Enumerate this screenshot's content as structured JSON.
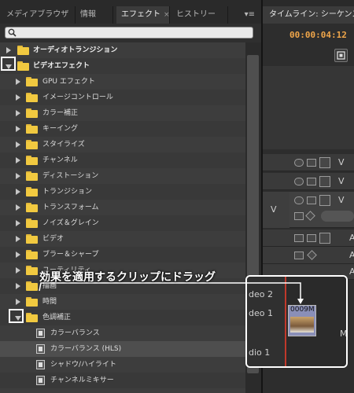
{
  "panel_tabs": [
    {
      "label": "メディアブラウザ",
      "active": false
    },
    {
      "label": "情報",
      "active": false
    },
    {
      "label": "エフェクト",
      "active": true,
      "close": "×"
    },
    {
      "label": "ヒストリー",
      "active": false
    }
  ],
  "panel_menu_glyph": "▾≡",
  "search": {
    "placeholder": ""
  },
  "tree": [
    {
      "label": "オーディオトランジション",
      "kind": "folder",
      "level": 0,
      "expanded": false,
      "bold": true
    },
    {
      "label": "ビデオエフェクト",
      "kind": "folder",
      "level": 0,
      "expanded": true,
      "bold": true
    },
    {
      "label": "GPU エフェクト",
      "kind": "folder",
      "level": 1,
      "expanded": false
    },
    {
      "label": "イメージコントロール",
      "kind": "folder",
      "level": 1,
      "expanded": false
    },
    {
      "label": "カラー補正",
      "kind": "folder",
      "level": 1,
      "expanded": false
    },
    {
      "label": "キーイング",
      "kind": "folder",
      "level": 1,
      "expanded": false
    },
    {
      "label": "スタイライズ",
      "kind": "folder",
      "level": 1,
      "expanded": false
    },
    {
      "label": "チャンネル",
      "kind": "folder",
      "level": 1,
      "expanded": false
    },
    {
      "label": "ディストーション",
      "kind": "folder",
      "level": 1,
      "expanded": false
    },
    {
      "label": "トランジション",
      "kind": "folder",
      "level": 1,
      "expanded": false
    },
    {
      "label": "トランスフォーム",
      "kind": "folder",
      "level": 1,
      "expanded": false
    },
    {
      "label": "ノイズ＆グレイン",
      "kind": "folder",
      "level": 1,
      "expanded": false
    },
    {
      "label": "ビデオ",
      "kind": "folder",
      "level": 1,
      "expanded": false
    },
    {
      "label": "ブラー＆シャープ",
      "kind": "folder",
      "level": 1,
      "expanded": false
    },
    {
      "label": "ユーティリティ",
      "kind": "folder",
      "level": 1,
      "expanded": false
    },
    {
      "label": "描画",
      "kind": "folder",
      "level": 1,
      "expanded": false
    },
    {
      "label": "時間",
      "kind": "folder",
      "level": 1,
      "expanded": false
    },
    {
      "label": "色調補正",
      "kind": "folder",
      "level": 1,
      "expanded": true
    },
    {
      "label": "カラーバランス",
      "kind": "effect",
      "level": 2
    },
    {
      "label": "カラーバランス (HLS)",
      "kind": "effect",
      "level": 2,
      "selected": true
    },
    {
      "label": "シャドウ/ハイライト",
      "kind": "effect",
      "level": 2
    },
    {
      "label": "チャンネルミキサー",
      "kind": "effect",
      "level": 2
    }
  ],
  "timeline": {
    "tab_label": "タイムライン: シーケンス",
    "timecode": "00:00:04:12",
    "track_letters": [
      "V",
      "V",
      "V",
      "A",
      "A",
      "A"
    ],
    "track_label_v": "V",
    "zoom_labels": [
      "deo 2",
      "deo 1",
      "dio 1"
    ],
    "clip_label": "0009M",
    "track_letter_m": "M"
  },
  "annotation": {
    "callout": "効果を適用するクリップにドラッグ"
  },
  "colors": {
    "timecode": "#f0a64a",
    "folder": "#f1c940",
    "playhead": "#c0392b"
  }
}
